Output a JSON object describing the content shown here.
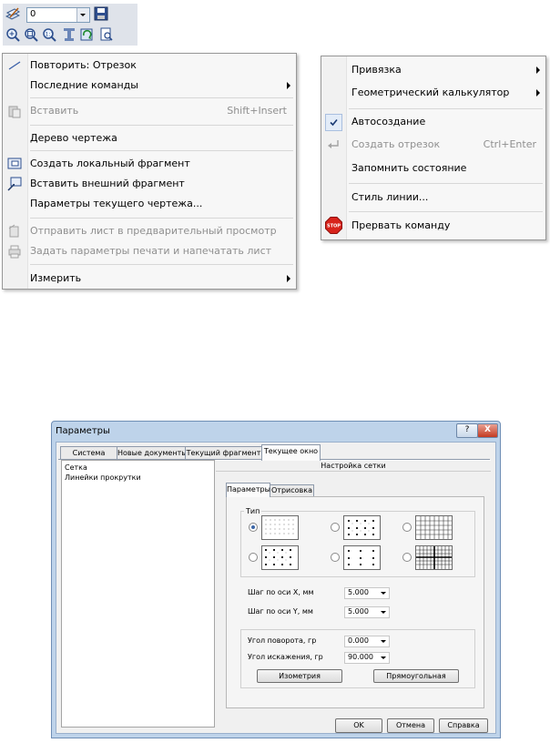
{
  "toolbar": {
    "layer_value": "0",
    "icons": [
      "layers-icon",
      "save-icon",
      "zoom-in-icon",
      "zoom-window-icon",
      "zoom-all-icon",
      "pan-icon",
      "refresh-icon",
      "page-preview-icon"
    ]
  },
  "menu1": {
    "items": [
      {
        "label": "Повторить: Отрезок"
      },
      {
        "label": "Последние команды"
      },
      {
        "label": "Вставить",
        "shortcut": "Shift+Insert"
      },
      {
        "label": "Дерево чертежа"
      },
      {
        "label": "Создать локальный фрагмент"
      },
      {
        "label": "Вставить внешний фрагмент"
      },
      {
        "label": "Параметры текущего чертежа..."
      },
      {
        "label": "Отправить лист в предварительный просмотр"
      },
      {
        "label": "Задать параметры печати и напечатать лист"
      },
      {
        "label": "Измерить"
      }
    ]
  },
  "menu2": {
    "items": [
      {
        "label": "Привязка"
      },
      {
        "label": "Геометрический калькулятор"
      },
      {
        "label": "Автосоздание"
      },
      {
        "label": "Создать отрезок",
        "shortcut": "Ctrl+Enter"
      },
      {
        "label": "Запомнить состояние"
      },
      {
        "label": "Стиль линии..."
      },
      {
        "label": "Прервать команду"
      }
    ],
    "stop_text": "STOP"
  },
  "dialog": {
    "title": "Параметры",
    "help_btn": "?",
    "close_btn": "X",
    "tabs": [
      "Система",
      "Новые документы",
      "Текущий фрагмент",
      "Текущее окно"
    ],
    "tree": [
      "Сетка",
      "Линейки прокрутки"
    ],
    "section_title": "Настройка сетки",
    "inner_tabs": [
      "Параметры",
      "Отрисовка"
    ],
    "type_label": "Тип",
    "step_x_label": "Шаг по оси X, мм",
    "step_x_value": "5.000",
    "step_y_label": "Шаг по оси Y, мм",
    "step_y_value": "5.000",
    "angle_label": "Угол поворота, гр",
    "angle_value": "0.000",
    "skew_label": "Угол искажения, гр",
    "skew_value": "90.000",
    "isometry_btn": "Изометрия",
    "rect_btn": "Прямоугольная",
    "ok": "OK",
    "cancel": "Отмена",
    "help": "Справка"
  }
}
